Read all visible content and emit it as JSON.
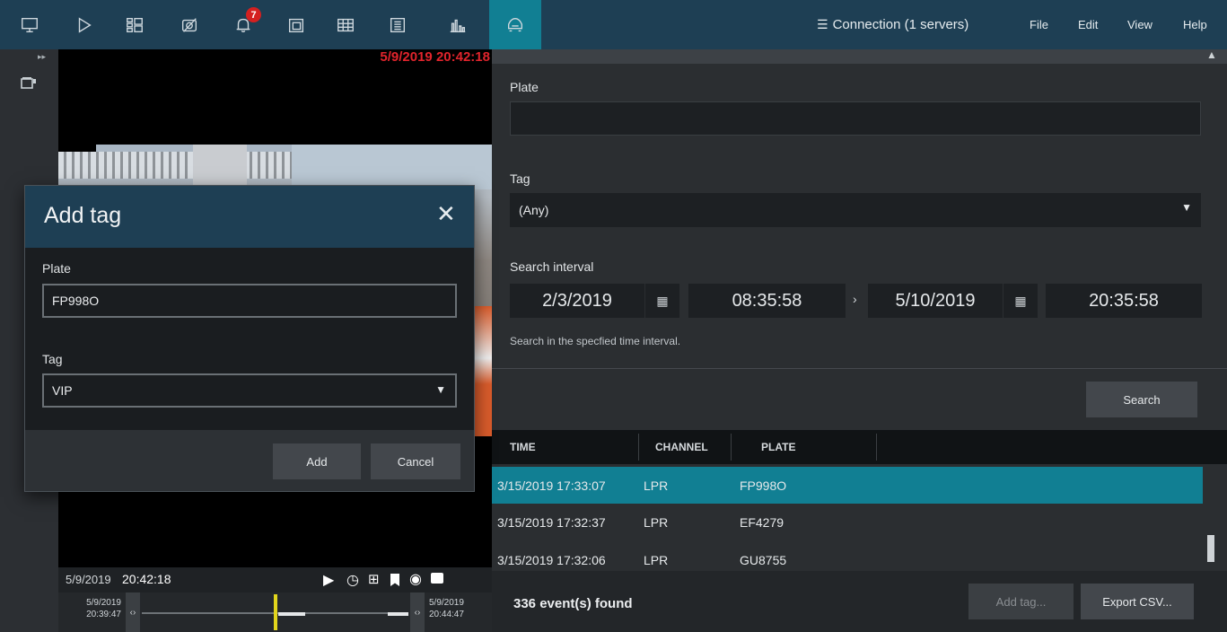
{
  "topbar": {
    "icons": [
      "monitor-icon",
      "play-icon",
      "layout-icon",
      "camera-off-icon",
      "bell-icon",
      "archive-icon",
      "grid-icon",
      "keypad-icon",
      "stats-icon",
      "car-icon"
    ],
    "notification_count": "7",
    "connection_label": "Connection (1 servers)",
    "menu": [
      "File",
      "Edit",
      "View",
      "Help"
    ]
  },
  "video": {
    "timestamp": "5/9/2019 20:42:18"
  },
  "player": {
    "date": "5/9/2019",
    "time": "20:42:18",
    "timeline_left_date": "5/9/2019",
    "timeline_left_time": "20:39:47",
    "timeline_right_date": "5/9/2019",
    "timeline_right_time": "20:44:47"
  },
  "search": {
    "plate_label": "Plate",
    "plate_value": "",
    "tag_label": "Tag",
    "tag_value": "(Any)",
    "interval_label": "Search interval",
    "from_date": "2/3/2019",
    "from_time": "08:35:58",
    "to_date": "5/10/2019",
    "to_time": "20:35:58",
    "interval_hint": "Search in the specfied time interval.",
    "search_button": "Search"
  },
  "table": {
    "columns": [
      "TIME",
      "CHANNEL",
      "PLATE"
    ],
    "rows": [
      {
        "time": "3/15/2019 17:33:07",
        "channel": "LPR",
        "plate": "FP998O"
      },
      {
        "time": "3/15/2019 17:32:37",
        "channel": "LPR",
        "plate": "EF4279"
      },
      {
        "time": "3/15/2019 17:32:06",
        "channel": "LPR",
        "plate": "GU8755"
      }
    ]
  },
  "footer": {
    "count_text": "336 event(s) found",
    "add_tag_button": "Add tag...",
    "export_button": "Export CSV..."
  },
  "modal": {
    "title": "Add tag",
    "plate_label": "Plate",
    "plate_value": "FP998O",
    "tag_label": "Tag",
    "tag_value": "VIP",
    "add_button": "Add",
    "cancel_button": "Cancel"
  },
  "colors": {
    "topbar": "#1e3f54",
    "accent": "#117f93",
    "badge": "#d42020",
    "timestamp": "#e0242c"
  }
}
